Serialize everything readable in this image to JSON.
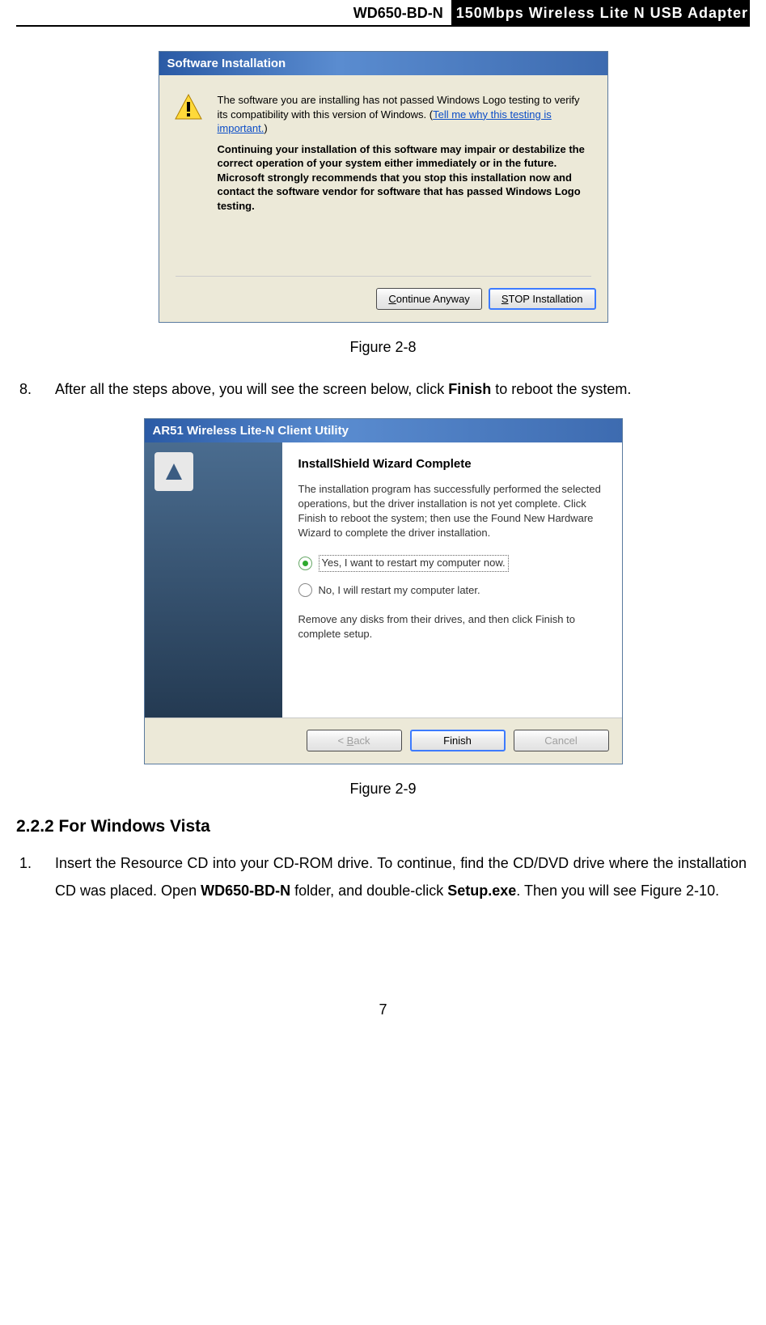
{
  "header": {
    "left": "WD650-BD-N",
    "right": "150Mbps Wireless Lite N USB Adapter"
  },
  "dlg1": {
    "title": "Software Installation",
    "para1_a": "The software you are installing has not passed Windows Logo testing to verify its compatibility with this version of Windows. (",
    "link": "Tell me why this testing is important.",
    "para1_b": ")",
    "bold1": "Continuing your installation of this software may impair or destabilize the correct operation of your system either immediately or in the future. Microsoft strongly recommends that you stop this installation now and contact the software vendor for software that has passed Windows Logo testing.",
    "btn_continue_pre": "C",
    "btn_continue_rest": "ontinue Anyway",
    "btn_stop_pre": "S",
    "btn_stop_rest": "TOP Installation"
  },
  "fig1_caption": "Figure 2-8",
  "step8": {
    "num": "8.",
    "text_a": "After all the steps above, you will see the screen below, click ",
    "bold": "Finish",
    "text_b": " to reboot the system."
  },
  "dlg2": {
    "title": "AR51 Wireless Lite-N Client Utility",
    "heading": "InstallShield Wizard Complete",
    "para": "The installation program has successfully performed the selected operations, but the driver installation is not yet complete. Click Finish to reboot the system; then use the Found New Hardware Wizard to complete the driver installation.",
    "radio_yes": "Yes, I want to restart my computer now.",
    "radio_no": "No, I will restart my computer later.",
    "para2": "Remove any disks from their drives, and then click Finish to complete setup.",
    "btn_back_pre": "< ",
    "btn_back_u": "B",
    "btn_back_rest": "ack",
    "btn_finish": "Finish",
    "btn_cancel": "Cancel"
  },
  "fig2_caption": "Figure 2-9",
  "section": "2.2.2  For Windows Vista",
  "step1": {
    "num": "1.",
    "text_a": "Insert the Resource CD into your CD-ROM drive. To continue, find the CD/DVD drive where the installation CD was placed. Open ",
    "bold1": "WD650-BD-N",
    "text_b": " folder, and double-click ",
    "bold2": "Setup.exe",
    "text_c": ". Then you will see Figure 2-10."
  },
  "pagenum": "7"
}
